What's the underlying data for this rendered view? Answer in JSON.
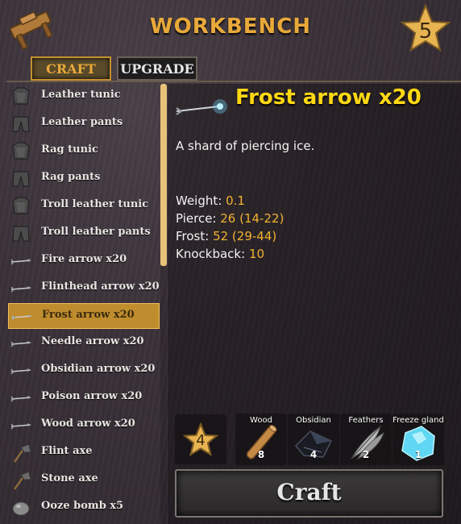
{
  "header": {
    "title": "WORKBENCH",
    "station_level": "5",
    "station_icon": "workbench-icon"
  },
  "tabs": [
    {
      "label": "CRAFT",
      "active": true
    },
    {
      "label": "UPGRADE",
      "active": false
    }
  ],
  "recipes": [
    {
      "label": "Leather tunic",
      "icon": "tunic-icon"
    },
    {
      "label": "Leather pants",
      "icon": "pants-icon"
    },
    {
      "label": "Rag tunic",
      "icon": "tunic-icon"
    },
    {
      "label": "Rag pants",
      "icon": "pants-icon"
    },
    {
      "label": "Troll leather tunic",
      "icon": "tunic-icon"
    },
    {
      "label": "Troll leather pants",
      "icon": "pants-icon"
    },
    {
      "label": "Fire arrow x20",
      "icon": "arrow-icon"
    },
    {
      "label": "Flinthead arrow x20",
      "icon": "arrow-icon"
    },
    {
      "label": "Frost arrow x20",
      "icon": "arrow-icon",
      "selected": true
    },
    {
      "label": "Needle arrow x20",
      "icon": "arrow-icon"
    },
    {
      "label": "Obsidian arrow x20",
      "icon": "arrow-icon"
    },
    {
      "label": "Poison arrow x20",
      "icon": "arrow-icon"
    },
    {
      "label": "Wood arrow x20",
      "icon": "arrow-icon"
    },
    {
      "label": "Flint axe",
      "icon": "axe-icon"
    },
    {
      "label": "Stone axe",
      "icon": "axe-icon"
    },
    {
      "label": "Ooze bomb x5",
      "icon": "bomb-icon"
    }
  ],
  "detail": {
    "name": "Frost arrow x20",
    "description": "A shard of piercing ice.",
    "stats": [
      {
        "label": "Weight: ",
        "value": "0.1"
      },
      {
        "label": "Pierce: ",
        "value": "26 (14-22)"
      },
      {
        "label": "Frost: ",
        "value": "52 (29-44)"
      },
      {
        "label": "Knockback: ",
        "value": "10"
      }
    ]
  },
  "requirements": {
    "level": "4",
    "resources": [
      {
        "name": "Wood",
        "qty": "8",
        "icon": "wood-icon"
      },
      {
        "name": "Obsidian",
        "qty": "4",
        "icon": "obsidian-icon"
      },
      {
        "name": "Feathers",
        "qty": "2",
        "icon": "feathers-icon"
      },
      {
        "name": "Freeze gland",
        "qty": "1",
        "icon": "freeze-gland-icon"
      }
    ]
  },
  "craft_button": {
    "label": "Craft"
  },
  "colors": {
    "accent": "#e9a93a",
    "selected_bg": "#c08d2e",
    "item_title": "#ffd814",
    "stat_value": "#f2b232"
  }
}
